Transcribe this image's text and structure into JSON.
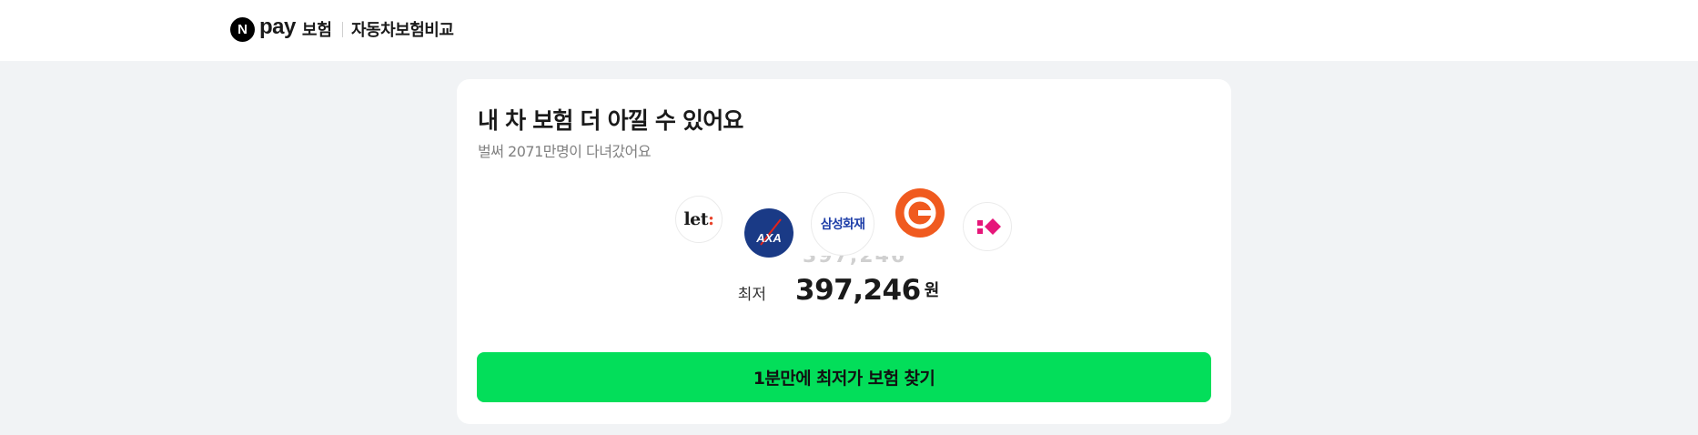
{
  "header": {
    "logo_letter": "N",
    "brand_pay": "pay",
    "brand_insurance": "보험",
    "title": "자동차보험비교"
  },
  "card": {
    "headline": "내 차 보험 더 아낄 수 있어요",
    "subhead": "벌써 2071만명이 다녀갔어요",
    "insurer_logos": [
      {
        "name": "let",
        "text": "let",
        "accent": ":"
      },
      {
        "name": "axa",
        "text": "AXA"
      },
      {
        "name": "samsung-fire",
        "text": "삼성화재"
      },
      {
        "name": "carrot",
        "text": ""
      },
      {
        "name": "kb",
        "text": ""
      }
    ],
    "price": {
      "prefix": "최저",
      "value": "397,246",
      "unit": "원",
      "ghost_value": "397,246"
    },
    "cta_label": "1분만에 최저가 보험 찾기"
  },
  "colors": {
    "accent_green": "#03de5a",
    "background": "#f1f3f5",
    "axa_blue": "#1a3a86",
    "carrot_orange": "#f05a1f",
    "kb_pink": "#e6177a",
    "samsung_blue": "#1f3fa8"
  }
}
